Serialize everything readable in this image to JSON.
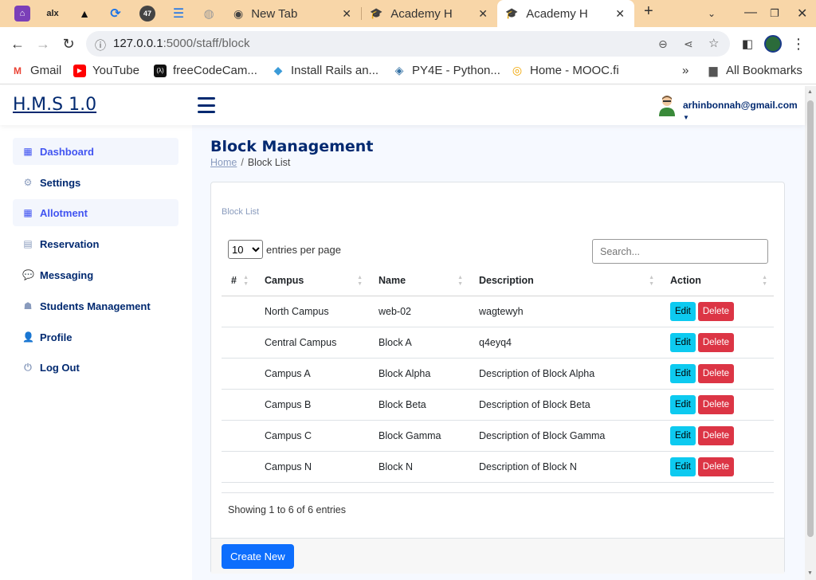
{
  "browser": {
    "tabs": [
      {
        "title": "New Tab"
      },
      {
        "title": "Academy Haven"
      },
      {
        "title": "Academy Haven"
      }
    ],
    "pinned": [
      {
        "icon": "hostel-app-icon"
      },
      {
        "icon": "alx-icon",
        "text": "alx"
      },
      {
        "icon": "triangle-icon"
      },
      {
        "icon": "sync-icon"
      },
      {
        "icon": "notification-icon",
        "text": "47"
      },
      {
        "icon": "docs-icon"
      },
      {
        "icon": "globe-icon"
      }
    ],
    "url": {
      "host": "127.0.0.1",
      "path": ":5000/staff/block"
    },
    "bookmarks": [
      {
        "label": "Gmail",
        "icon": "gmail-icon"
      },
      {
        "label": "YouTube",
        "icon": "youtube-icon"
      },
      {
        "label": "freeCodeCam...",
        "icon": "freecodecamp-icon"
      },
      {
        "label": "Install Rails an...",
        "icon": "ruby-icon"
      },
      {
        "label": "PY4E - Python...",
        "icon": "python-icon"
      },
      {
        "label": "Home - MOOC.fi",
        "icon": "mooc-icon"
      }
    ],
    "all_bookmarks": "All Bookmarks"
  },
  "app": {
    "brand": "H.M.S 1.0",
    "user_email": "arhinbonnah@gmail.com",
    "sidebar": [
      {
        "label": "Dashboard",
        "icon": "grid-icon",
        "highlighted": true
      },
      {
        "label": "Settings",
        "icon": "gear-icon",
        "highlighted": false
      },
      {
        "label": "Allotment",
        "icon": "grid-icon",
        "highlighted": true
      },
      {
        "label": "Reservation",
        "icon": "document-icon",
        "highlighted": false
      },
      {
        "label": "Messaging",
        "icon": "chat-icon",
        "highlighted": false
      },
      {
        "label": "Students Management",
        "icon": "students-icon",
        "highlighted": false
      },
      {
        "label": "Profile",
        "icon": "person-icon",
        "highlighted": false
      },
      {
        "label": "Log Out",
        "icon": "logout-icon",
        "highlighted": false
      }
    ],
    "page_title": "Block Management",
    "breadcrumb": {
      "home": "Home",
      "separator": "/",
      "current": "Block List"
    },
    "card_title": "Block List",
    "entries": {
      "selected": "10",
      "label": "entries per page"
    },
    "search_placeholder": "Search...",
    "columns": [
      "#",
      "Campus",
      "Name",
      "Description",
      "Action"
    ],
    "rows": [
      {
        "num": "",
        "campus": "North Campus",
        "name": "web-02",
        "description": "wagtewyh"
      },
      {
        "num": "",
        "campus": "Central Campus",
        "name": "Block A",
        "description": "q4eyq4"
      },
      {
        "num": "",
        "campus": "Campus A",
        "name": "Block Alpha",
        "description": "Description of Block Alpha"
      },
      {
        "num": "",
        "campus": "Campus B",
        "name": "Block Beta",
        "description": "Description of Block Beta"
      },
      {
        "num": "",
        "campus": "Campus C",
        "name": "Block Gamma",
        "description": "Description of Block Gamma"
      },
      {
        "num": "",
        "campus": "Campus N",
        "name": "Block N",
        "description": "Description of Block N"
      }
    ],
    "edit_label": "Edit",
    "delete_label": "Delete",
    "summary": "Showing 1 to 6 of 6 entries",
    "create_label": "Create New",
    "colors": {
      "navy": "#012970",
      "accent": "#4154f1",
      "edit": "#0dcaf0",
      "delete": "#dc3545",
      "primary": "#0d6efd",
      "tabstrip": "#f8d6a8"
    }
  }
}
